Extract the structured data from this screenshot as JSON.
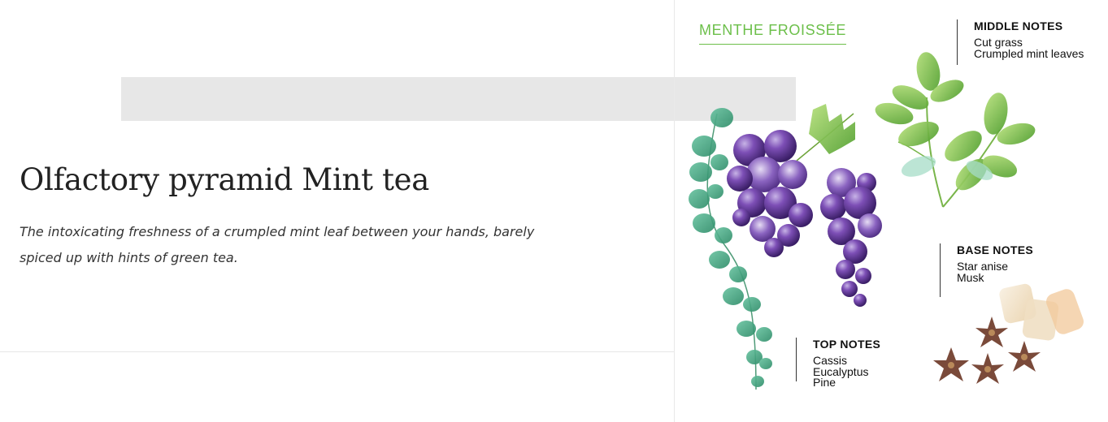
{
  "main": {
    "title": "Olfactory pyramid Mint tea",
    "description": "The intoxicating freshness of a crumpled mint leaf between your hands, barely spiced up with hints of green tea."
  },
  "pyramid": {
    "brand": "MENTHE FROISSÉE",
    "middle_notes": {
      "title": "MIDDLE NOTES",
      "items": [
        "Cut grass",
        "Crumpled mint leaves"
      ]
    },
    "base_notes": {
      "title": "BASE NOTES",
      "items": [
        "Star anise",
        "Musk"
      ]
    },
    "top_notes": {
      "title": "TOP NOTES",
      "items": [
        "Cassis",
        "Eucalyptus",
        "Pine"
      ]
    }
  },
  "colors": {
    "accent_green": "#6cbf4a",
    "grape_purple": "#6a3fa0",
    "leaf_green": "#7cc24a",
    "eucalyptus": "#3fa37a",
    "anise_brown": "#7a4a3a"
  }
}
